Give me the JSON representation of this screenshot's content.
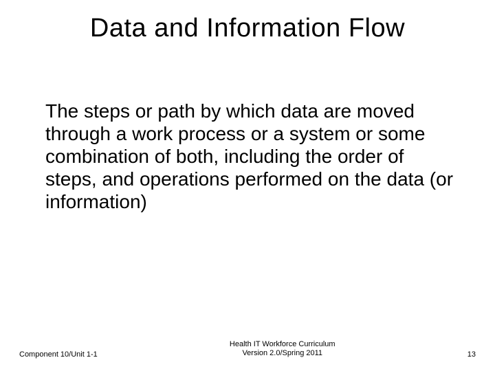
{
  "title": "Data and Information Flow",
  "body": "The steps or path by which data are moved through a work process or a system or some combination of both, including the order of steps, and operations performed on the data (or information)",
  "footer": {
    "left": "Component 10/Unit 1-1",
    "center_line1": "Health IT Workforce Curriculum",
    "center_line2": "Version 2.0/Spring 2011",
    "right": "13"
  }
}
